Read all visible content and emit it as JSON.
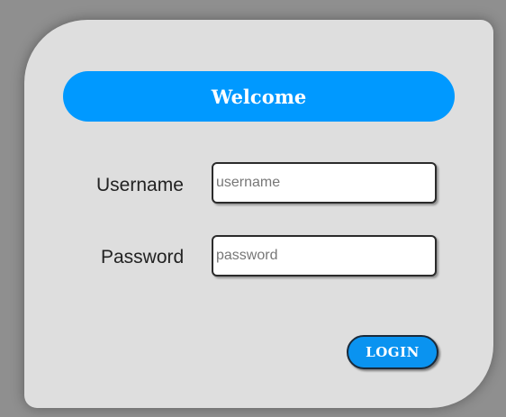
{
  "header": {
    "title": "Welcome"
  },
  "form": {
    "username_label": "Username",
    "username_placeholder": "username",
    "username_value": "",
    "password_label": "Password",
    "password_placeholder": "password",
    "password_value": ""
  },
  "actions": {
    "login_label": "LOGIN"
  },
  "colors": {
    "accent": "#0099ff",
    "card_background": "#dedede",
    "page_background": "#8f8f8f"
  }
}
